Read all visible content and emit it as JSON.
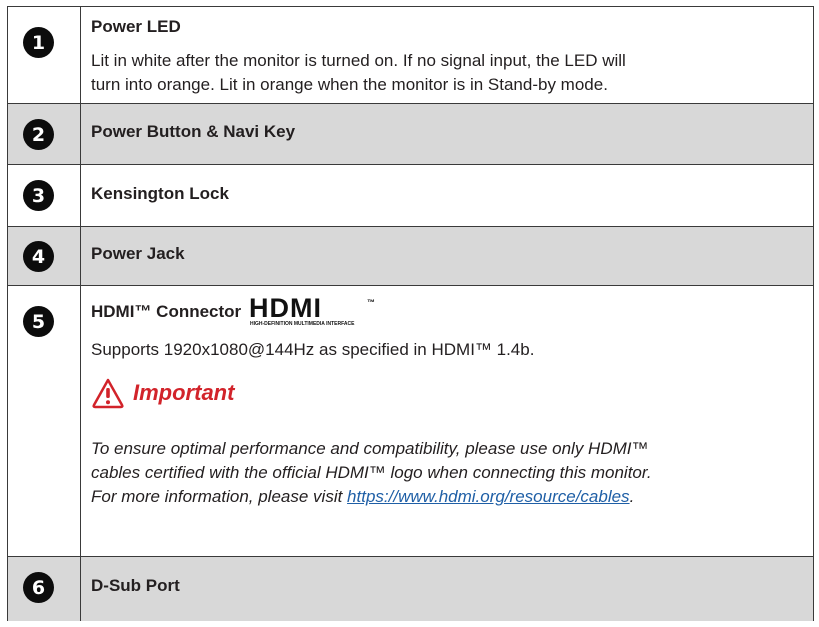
{
  "rows": [
    {
      "number": "1",
      "title": "Power LED",
      "description_lines": [
        "Lit in white after the monitor is turned on. If no signal input, the LED will",
        "turn into orange. Lit in orange when the monitor is in Stand-by mode."
      ]
    },
    {
      "number": "2",
      "title": "Power Button & Navi Key"
    },
    {
      "number": "3",
      "title": "Kensington Lock"
    },
    {
      "number": "4",
      "title": "Power Jack"
    },
    {
      "number": "5",
      "title": "HDMI™ Connector",
      "logo": {
        "text": "HDMI",
        "trademark": "™",
        "tagline": "HIGH-DEFINITION MULTIMEDIA INTERFACE"
      },
      "description": "Supports 1920x1080@144Hz as specified in HDMI™ 1.4b.",
      "important_label": "Important",
      "important_lines": [
        "To ensure optimal performance and compatibility, please use only HDMI™",
        "cables certified with the official HDMI™ logo when connecting this monitor.",
        "For more information, please visit "
      ],
      "important_link": "https://www.hdmi.org/resource/cables",
      "important_tail": "."
    },
    {
      "number": "6",
      "title": "D-Sub Port"
    }
  ],
  "colors": {
    "shade": "#d8d8d8",
    "important": "#d2232a",
    "link": "#1f5fa6"
  },
  "icons": {
    "number_badge": "filled-circle",
    "important": "warning-triangle-icon"
  }
}
